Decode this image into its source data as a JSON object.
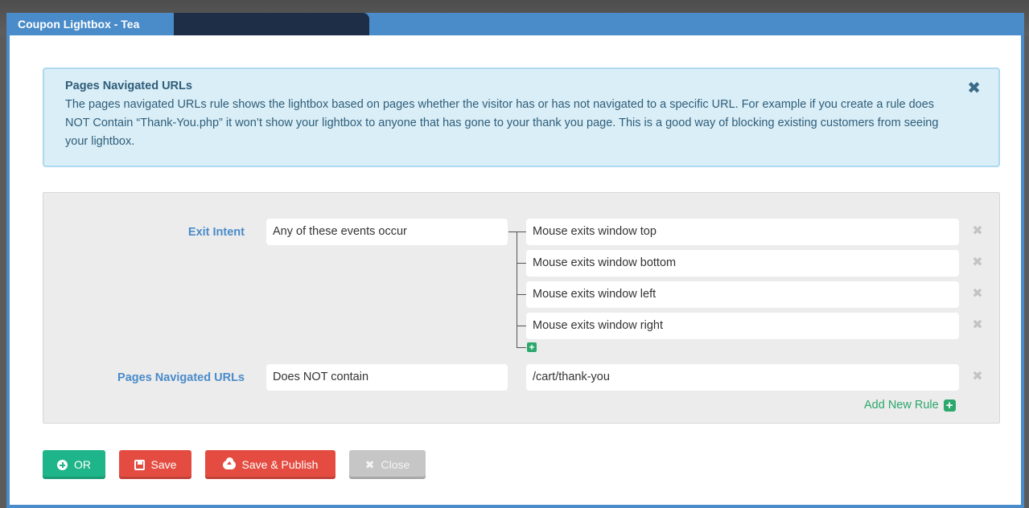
{
  "modal": {
    "title": "Coupon Lightbox - Tea"
  },
  "info_box": {
    "title": "Pages Navigated URLs",
    "body": "The pages navigated URLs rule shows the lightbox based on pages whether the visitor has or has not navigated to a specific URL. For example if you create a rule does NOT Contain “Thank-You.php” it won’t show your lightbox to anyone that has gone to your thank you page. This is a good way of blocking existing customers from seeing your lightbox.",
    "close_icon": "✖"
  },
  "rules": [
    {
      "label": "Exit Intent",
      "condition": "Any of these events occur",
      "values": [
        "Mouse exits window top",
        "Mouse exits window bottom",
        "Mouse exits window left",
        "Mouse exits window right"
      ]
    },
    {
      "label": "Pages Navigated URLs",
      "condition": "Does NOT contain",
      "values": [
        "/cart/thank-you"
      ]
    }
  ],
  "remove_icon": "✖",
  "add_value_icon": "+",
  "add_new_rule": "Add New Rule",
  "add_new_rule_icon": "+",
  "buttons": {
    "or": "OR",
    "save": "Save",
    "save_publish": "Save & Publish",
    "close": "Close",
    "close_icon": "✖"
  },
  "colors": {
    "modal_border": "#4a8bc9",
    "tab_dark": "#1e2e47",
    "info_bg": "#d9eef7",
    "rule_label": "#4a8bc9",
    "green": "#1fb58a",
    "red": "#e44c41",
    "grey": "#c6c6c6"
  }
}
